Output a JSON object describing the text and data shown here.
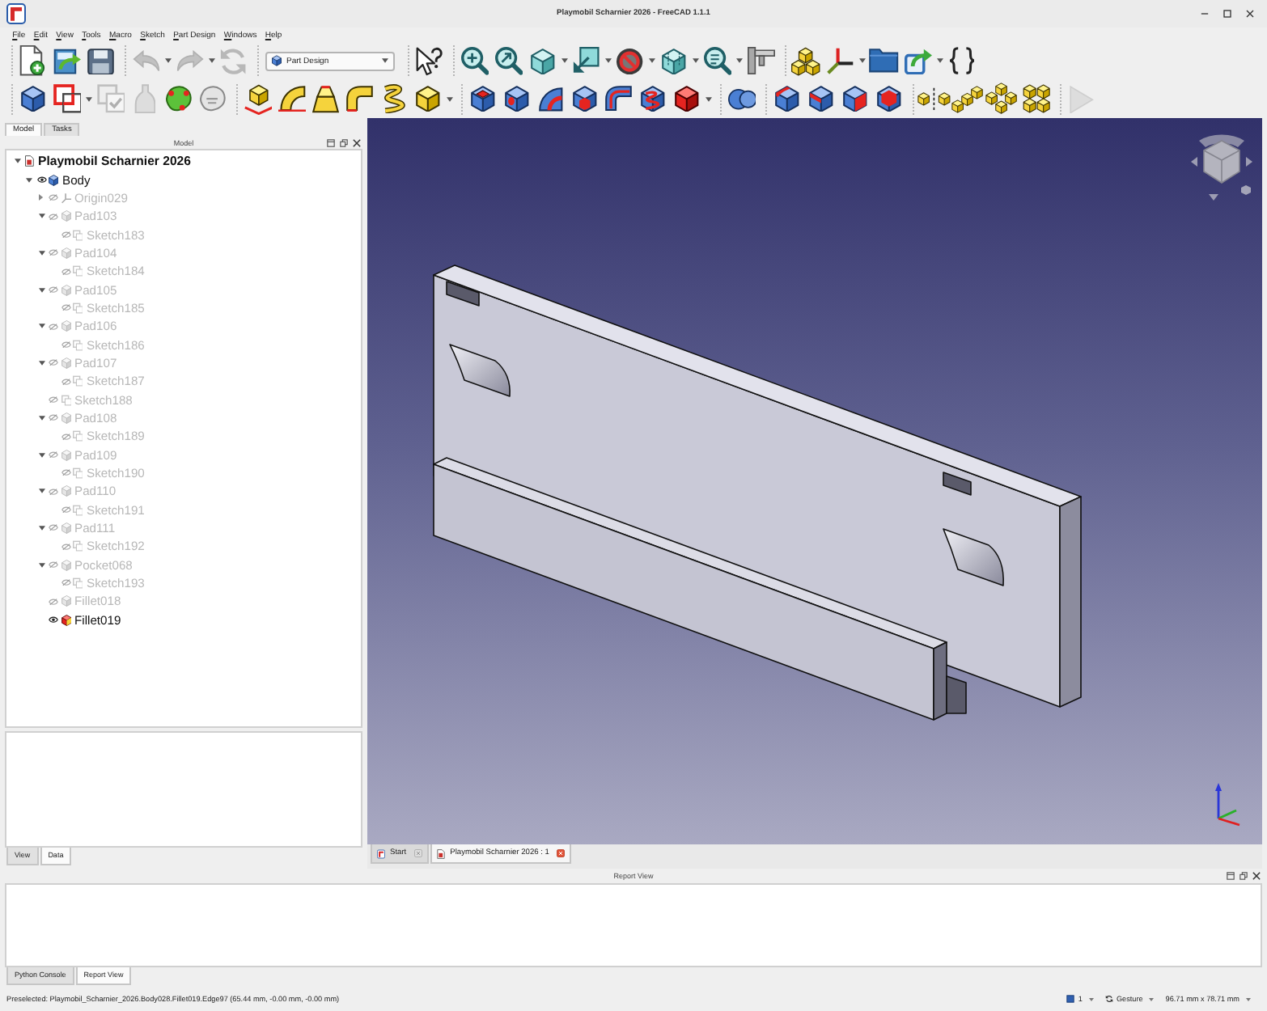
{
  "window": {
    "title": "Playmobil Scharnier 2026 - FreeCAD 1.1.1"
  },
  "menu": [
    "File",
    "Edit",
    "View",
    "Tools",
    "Macro",
    "Sketch",
    "Part Design",
    "Windows",
    "Help"
  ],
  "toolbar_rows": [
    [
      {
        "kind": "buttons",
        "items": [
          {
            "kind": "new",
            "disabled": false
          },
          {
            "kind": "open",
            "disabled": false
          },
          {
            "kind": "save",
            "disabled": false
          }
        ]
      },
      {
        "kind": "buttons",
        "items": [
          {
            "kind": "undo",
            "disabled": true
          },
          {
            "kind": "redo",
            "disabled": true
          },
          {
            "kind": "recompute",
            "disabled": true
          }
        ]
      },
      {
        "kind": "combo",
        "value": "Part Design"
      },
      {
        "kind": "buttons",
        "items": [
          {
            "kind": "whatsthis",
            "disabled": false
          }
        ]
      },
      {
        "kind": "buttons",
        "items": [
          {
            "kind": "fitall",
            "disabled": false
          },
          {
            "kind": "fitselection",
            "disabled": false
          },
          {
            "kind": "isometric",
            "disabled": false
          },
          {
            "kind": "viewfront",
            "disabled": false
          },
          {
            "kind": "drawstyle",
            "disabled": false
          },
          {
            "kind": "boxview",
            "disabled": false
          },
          {
            "kind": "zoom",
            "disabled": false
          },
          {
            "kind": "measure",
            "disabled": false
          }
        ]
      },
      {
        "kind": "buttons",
        "items": [
          {
            "kind": "part",
            "disabled": false
          },
          {
            "kind": "lcs",
            "disabled": false
          },
          {
            "kind": "group",
            "disabled": false
          },
          {
            "kind": "link",
            "disabled": false
          },
          {
            "kind": "varset",
            "disabled": false
          }
        ]
      }
    ],
    [
      {
        "kind": "buttons",
        "items": [
          {
            "kind": "body",
            "disabled": false
          },
          {
            "kind": "sketch",
            "disabled": false
          },
          {
            "kind": "validate",
            "disabled": true
          },
          {
            "kind": "clone",
            "disabled": true
          },
          {
            "kind": "shapebinder",
            "disabled": false
          },
          {
            "kind": "subshapebinder",
            "disabled": false
          }
        ]
      },
      {
        "kind": "buttons",
        "items": [
          {
            "kind": "pad",
            "disabled": false
          },
          {
            "kind": "revolution",
            "disabled": false
          },
          {
            "kind": "loft",
            "disabled": false
          },
          {
            "kind": "pipe",
            "disabled": false
          },
          {
            "kind": "helix",
            "disabled": false
          },
          {
            "kind": "addbox",
            "disabled": false
          }
        ]
      },
      {
        "kind": "buttons",
        "items": [
          {
            "kind": "pocket",
            "disabled": false
          },
          {
            "kind": "hole",
            "disabled": false
          },
          {
            "kind": "groove",
            "disabled": false
          },
          {
            "kind": "subloft",
            "disabled": false
          },
          {
            "kind": "subpipe",
            "disabled": false
          },
          {
            "kind": "subhelix",
            "disabled": false
          },
          {
            "kind": "subbox",
            "disabled": false
          }
        ]
      },
      {
        "kind": "buttons",
        "items": [
          {
            "kind": "boolean",
            "disabled": false
          }
        ]
      },
      {
        "kind": "buttons",
        "items": [
          {
            "kind": "fillet",
            "disabled": false
          },
          {
            "kind": "chamfer",
            "disabled": false
          },
          {
            "kind": "draft",
            "disabled": false
          },
          {
            "kind": "thickness",
            "disabled": false
          }
        ]
      },
      {
        "kind": "buttons",
        "items": [
          {
            "kind": "mirrored",
            "disabled": false
          },
          {
            "kind": "linearpattern",
            "disabled": false
          },
          {
            "kind": "polarpattern",
            "disabled": false
          },
          {
            "kind": "multitransform",
            "disabled": false
          }
        ]
      },
      {
        "kind": "buttons",
        "items": [
          {
            "kind": "play",
            "disabled": true
          }
        ]
      }
    ]
  ],
  "model_panel": {
    "tabs": [
      {
        "label": "Model",
        "selected": true
      },
      {
        "label": "Tasks",
        "selected": false
      }
    ],
    "title": "Model",
    "tree": [
      {
        "label": "Playmobil Scharnier 2026",
        "kind": "document",
        "expanded": true,
        "children": [
          {
            "label": "Body",
            "kind": "body",
            "visible": true,
            "expanded": true,
            "children": [
              {
                "label": "Origin029",
                "kind": "origin",
                "visible": false,
                "expanded": false
              },
              {
                "label": "Pad103",
                "kind": "pad",
                "visible": false,
                "expanded": true,
                "children": [
                  {
                    "label": "Sketch183",
                    "kind": "sketch",
                    "visible": false
                  }
                ]
              },
              {
                "label": "Pad104",
                "kind": "pad",
                "visible": false,
                "expanded": true,
                "children": [
                  {
                    "label": "Sketch184",
                    "kind": "sketch",
                    "visible": false
                  }
                ]
              },
              {
                "label": "Pad105",
                "kind": "pad",
                "visible": false,
                "expanded": true,
                "children": [
                  {
                    "label": "Sketch185",
                    "kind": "sketch",
                    "visible": false
                  }
                ]
              },
              {
                "label": "Pad106",
                "kind": "pad",
                "visible": false,
                "expanded": true,
                "children": [
                  {
                    "label": "Sketch186",
                    "kind": "sketch",
                    "visible": false
                  }
                ]
              },
              {
                "label": "Pad107",
                "kind": "pad",
                "visible": false,
                "expanded": true,
                "children": [
                  {
                    "label": "Sketch187",
                    "kind": "sketch",
                    "visible": false
                  }
                ]
              },
              {
                "label": "Sketch188",
                "kind": "sketch",
                "visible": false
              },
              {
                "label": "Pad108",
                "kind": "pad",
                "visible": false,
                "expanded": true,
                "children": [
                  {
                    "label": "Sketch189",
                    "kind": "sketch",
                    "visible": false
                  }
                ]
              },
              {
                "label": "Pad109",
                "kind": "pad",
                "visible": false,
                "expanded": true,
                "children": [
                  {
                    "label": "Sketch190",
                    "kind": "sketch",
                    "visible": false
                  }
                ]
              },
              {
                "label": "Pad110",
                "kind": "pad",
                "visible": false,
                "expanded": true,
                "children": [
                  {
                    "label": "Sketch191",
                    "kind": "sketch",
                    "visible": false
                  }
                ]
              },
              {
                "label": "Pad111",
                "kind": "pad",
                "visible": false,
                "expanded": true,
                "children": [
                  {
                    "label": "Sketch192",
                    "kind": "sketch",
                    "visible": false
                  }
                ]
              },
              {
                "label": "Pocket068",
                "kind": "pocket",
                "visible": false,
                "expanded": true,
                "children": [
                  {
                    "label": "Sketch193",
                    "kind": "sketch",
                    "visible": false
                  }
                ]
              },
              {
                "label": "Fillet018",
                "kind": "fillet",
                "visible": false
              },
              {
                "label": "Fillet019",
                "kind": "fillet",
                "visible": true
              }
            ]
          }
        ]
      }
    ],
    "property_tabs": [
      {
        "label": "View",
        "selected": false
      },
      {
        "label": "Data",
        "selected": true
      }
    ]
  },
  "document_tabs": [
    {
      "label": "Start",
      "kind": "start",
      "selected": false
    },
    {
      "label": "Playmobil Scharnier 2026 : 1",
      "kind": "document",
      "selected": true
    }
  ],
  "report_view": {
    "title": "Report View",
    "tabs": [
      {
        "label": "Python Console",
        "selected": false
      },
      {
        "label": "Report View",
        "selected": true
      }
    ]
  },
  "status_bar": {
    "message": "Preselected: Playmobil_Scharnier_2026.Body028.Fillet019.Edge97 (65.44 mm, -0.00 mm, -0.00 mm)",
    "counter": "1",
    "navigation_style": "Gesture",
    "dimensions": "96.71 mm x 78.71 mm"
  }
}
